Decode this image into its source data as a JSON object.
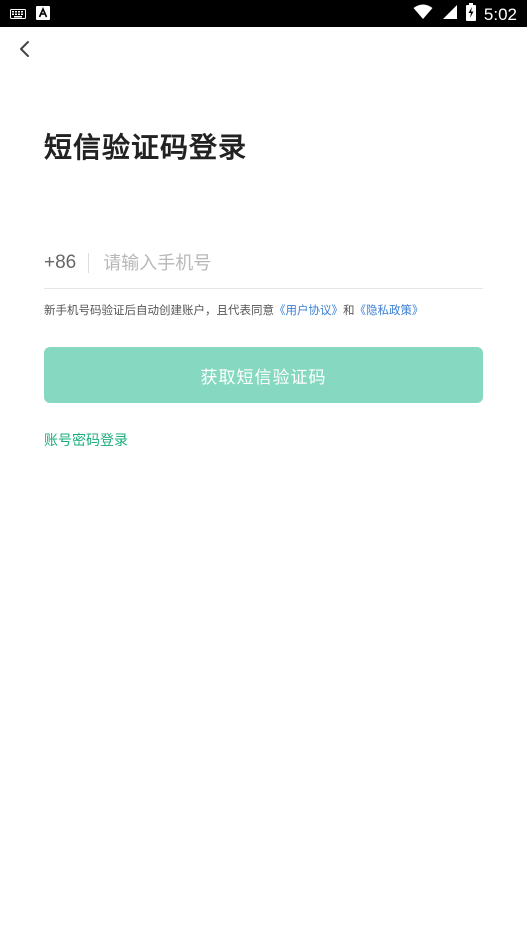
{
  "status_bar": {
    "time": "5:02",
    "left_icons": [
      "keyboard-icon",
      "text-a-icon"
    ],
    "right_icons": [
      "wifi-icon",
      "signal-icon",
      "battery-charging-icon"
    ]
  },
  "header": {
    "back_icon": "chevron-left-icon"
  },
  "title": "短信验证码登录",
  "phone": {
    "country_code": "+86",
    "placeholder": "请输入手机号",
    "value": ""
  },
  "notice": {
    "text": "新手机号码验证后自动创建账户，且代表同意",
    "agreement_link": "《用户协议》",
    "and_text": "和",
    "privacy_link": "《隐私政策》"
  },
  "get_code_button": {
    "label": "获取短信验证码",
    "color": "#86d9c0",
    "state": "disabled"
  },
  "password_login": {
    "label": "账号密码登录",
    "color": "#1aad7e"
  },
  "colors": {
    "accent": "#1aad7e",
    "link": "#3a7fd5",
    "status_bar": "#000000"
  }
}
